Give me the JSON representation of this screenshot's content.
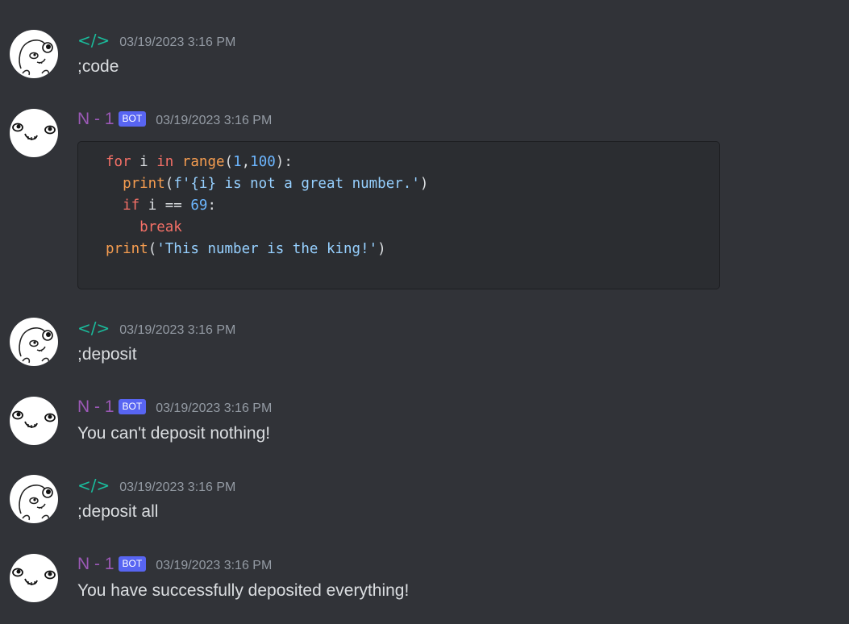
{
  "colors": {
    "background": "#313338",
    "user_name": "#1abc9c",
    "bot_name": "#9b59b6",
    "bot_badge": "#5865f2",
    "timestamp": "#949ba4",
    "message_text": "#dbdee1",
    "code_bg": "#2b2d31"
  },
  "messages": [
    {
      "author": "</>",
      "is_bot": false,
      "avatar": "trollface-user-avatar",
      "timestamp": "03/19/2023 3:16 PM",
      "text": ";code"
    },
    {
      "author": "N - 1",
      "is_bot": true,
      "badge": "BOT",
      "avatar": "derp-face-bot-avatar",
      "timestamp": "03/19/2023 3:16 PM",
      "code": {
        "language": "python",
        "lines": [
          [
            {
              "t": "for",
              "c": "kw"
            },
            {
              "t": " i ",
              "c": "pl"
            },
            {
              "t": "in",
              "c": "kw"
            },
            {
              "t": " ",
              "c": "pl"
            },
            {
              "t": "range",
              "c": "fn"
            },
            {
              "t": "(",
              "c": "pl"
            },
            {
              "t": "1",
              "c": "num"
            },
            {
              "t": ",",
              "c": "pl"
            },
            {
              "t": "100",
              "c": "num"
            },
            {
              "t": "):",
              "c": "pl"
            }
          ],
          [
            {
              "t": "  ",
              "c": "pl"
            },
            {
              "t": "print",
              "c": "fn"
            },
            {
              "t": "(",
              "c": "pl"
            },
            {
              "t": "f'{i} is not a great number.'",
              "c": "str"
            },
            {
              "t": ")",
              "c": "pl"
            }
          ],
          [
            {
              "t": "  ",
              "c": "pl"
            },
            {
              "t": "if",
              "c": "kw"
            },
            {
              "t": " i == ",
              "c": "pl"
            },
            {
              "t": "69",
              "c": "num"
            },
            {
              "t": ":",
              "c": "pl"
            }
          ],
          [
            {
              "t": "    ",
              "c": "pl"
            },
            {
              "t": "break",
              "c": "kw"
            }
          ],
          [
            {
              "t": "print",
              "c": "fn"
            },
            {
              "t": "(",
              "c": "pl"
            },
            {
              "t": "'This number is the king!'",
              "c": "str"
            },
            {
              "t": ")",
              "c": "pl"
            }
          ]
        ]
      }
    },
    {
      "author": "</>",
      "is_bot": false,
      "avatar": "trollface-user-avatar",
      "timestamp": "03/19/2023 3:16 PM",
      "text": ";deposit"
    },
    {
      "author": "N - 1",
      "is_bot": true,
      "badge": "BOT",
      "avatar": "derp-face-bot-avatar",
      "timestamp": "03/19/2023 3:16 PM",
      "text": "You can't deposit nothing!"
    },
    {
      "author": "</>",
      "is_bot": false,
      "avatar": "trollface-user-avatar",
      "timestamp": "03/19/2023 3:16 PM",
      "text": ";deposit all"
    },
    {
      "author": "N - 1",
      "is_bot": true,
      "badge": "BOT",
      "avatar": "derp-face-bot-avatar",
      "timestamp": "03/19/2023 3:16 PM",
      "text": "You have successfully deposited everything!"
    }
  ]
}
